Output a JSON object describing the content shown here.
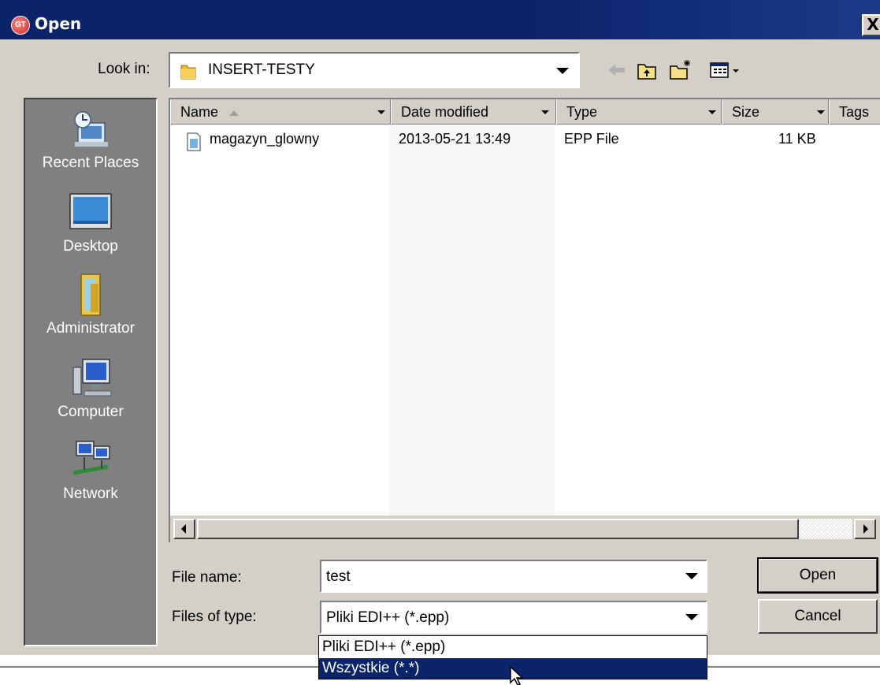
{
  "window": {
    "title": "Open",
    "logo_text": "GT",
    "close_glyph": "X"
  },
  "toolbar": {
    "look_in_label": "Look in:",
    "look_in_value": "INSERT-TESTY",
    "icons": [
      "back-icon",
      "up-folder-icon",
      "new-folder-icon",
      "view-menu-icon"
    ]
  },
  "places": [
    {
      "label": "Recent Places",
      "icon": "recent-places-icon"
    },
    {
      "label": "Desktop",
      "icon": "desktop-icon"
    },
    {
      "label": "Administrator",
      "icon": "user-folder-icon"
    },
    {
      "label": "Computer",
      "icon": "computer-icon"
    },
    {
      "label": "Network",
      "icon": "network-icon"
    }
  ],
  "file_list": {
    "columns": [
      "Name",
      "Date modified",
      "Type",
      "Size",
      "Tags"
    ],
    "rows": [
      {
        "name": "magazyn_glowny",
        "date": "2013-05-21 13:49",
        "type": "EPP File",
        "size": "11 KB"
      }
    ]
  },
  "form": {
    "file_name_label": "File name:",
    "file_name_value": "test",
    "file_type_label": "Files of type:",
    "file_type_value": "Pliki EDI++ (*.epp)",
    "type_options": [
      "Pliki EDI++ (*.epp)",
      "Wszystkie (*.*)"
    ]
  },
  "buttons": {
    "open": "Open",
    "cancel": "Cancel"
  },
  "colors": {
    "titlebar": "#0a246a",
    "face": "#d4d0c8",
    "places_bg": "#808080",
    "highlight": "#0a246a"
  }
}
